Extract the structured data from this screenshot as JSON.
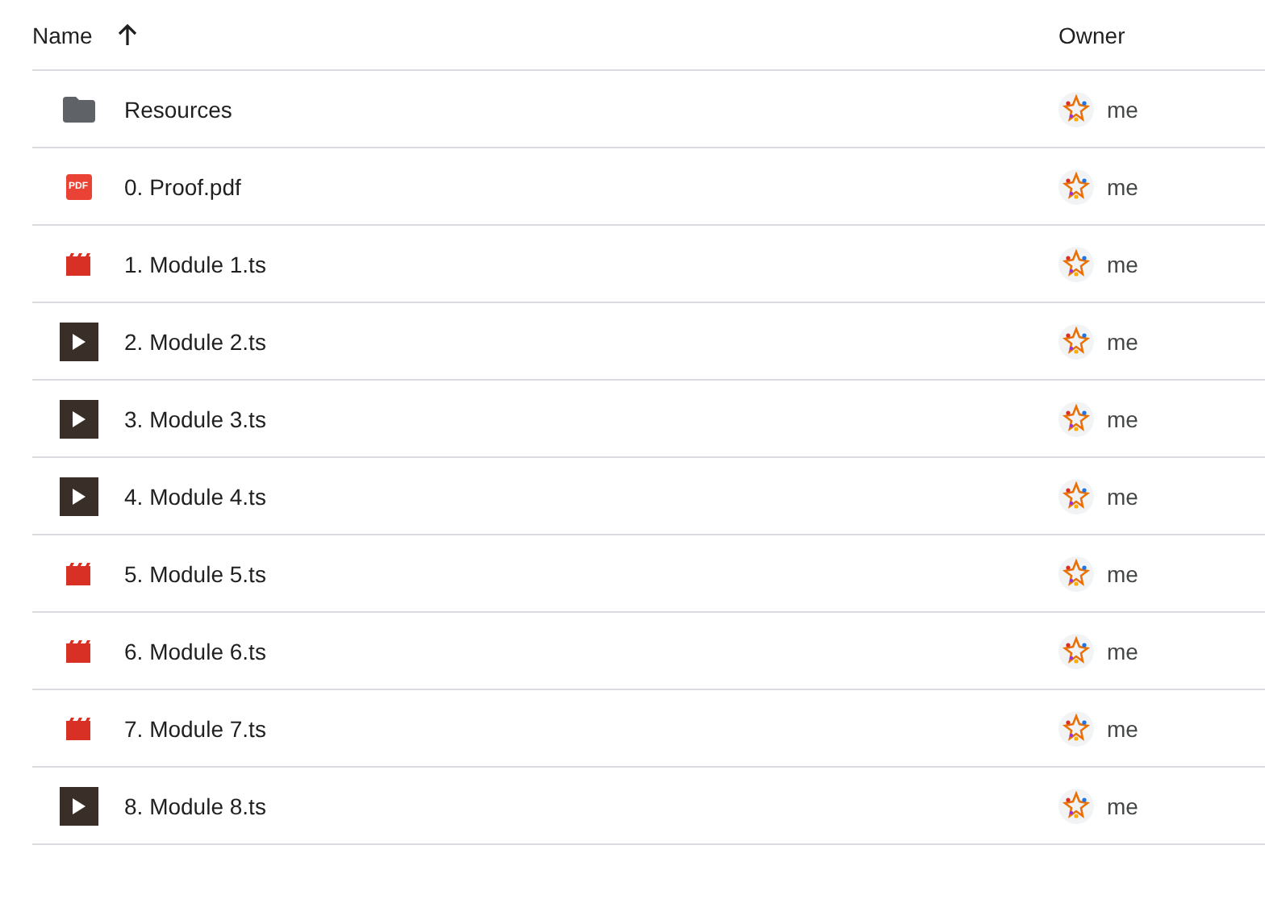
{
  "columns": [
    {
      "label": "Name",
      "sort_icon": true
    },
    {
      "label": "Owner"
    }
  ],
  "rows": [
    {
      "kind": "folder",
      "name": "Resources",
      "owner": "me"
    },
    {
      "kind": "pdf",
      "badge": "PDF",
      "name": "0. Proof.pdf",
      "owner": "me"
    },
    {
      "kind": "video",
      "name": "1. Module 1.ts",
      "owner": "me"
    },
    {
      "kind": "thumbnail",
      "name": "2. Module 2.ts",
      "owner": "me"
    },
    {
      "kind": "thumbnail",
      "name": "3. Module 3.ts",
      "owner": "me"
    },
    {
      "kind": "thumbnail",
      "name": "4. Module 4.ts",
      "owner": "me"
    },
    {
      "kind": "video",
      "name": "5. Module 5.ts",
      "owner": "me"
    },
    {
      "kind": "video",
      "name": "6. Module 6.ts",
      "owner": "me"
    },
    {
      "kind": "video",
      "name": "7. Module 7.ts",
      "owner": "me"
    },
    {
      "kind": "thumbnail",
      "name": "8. Module 8.ts",
      "owner": "me"
    }
  ]
}
